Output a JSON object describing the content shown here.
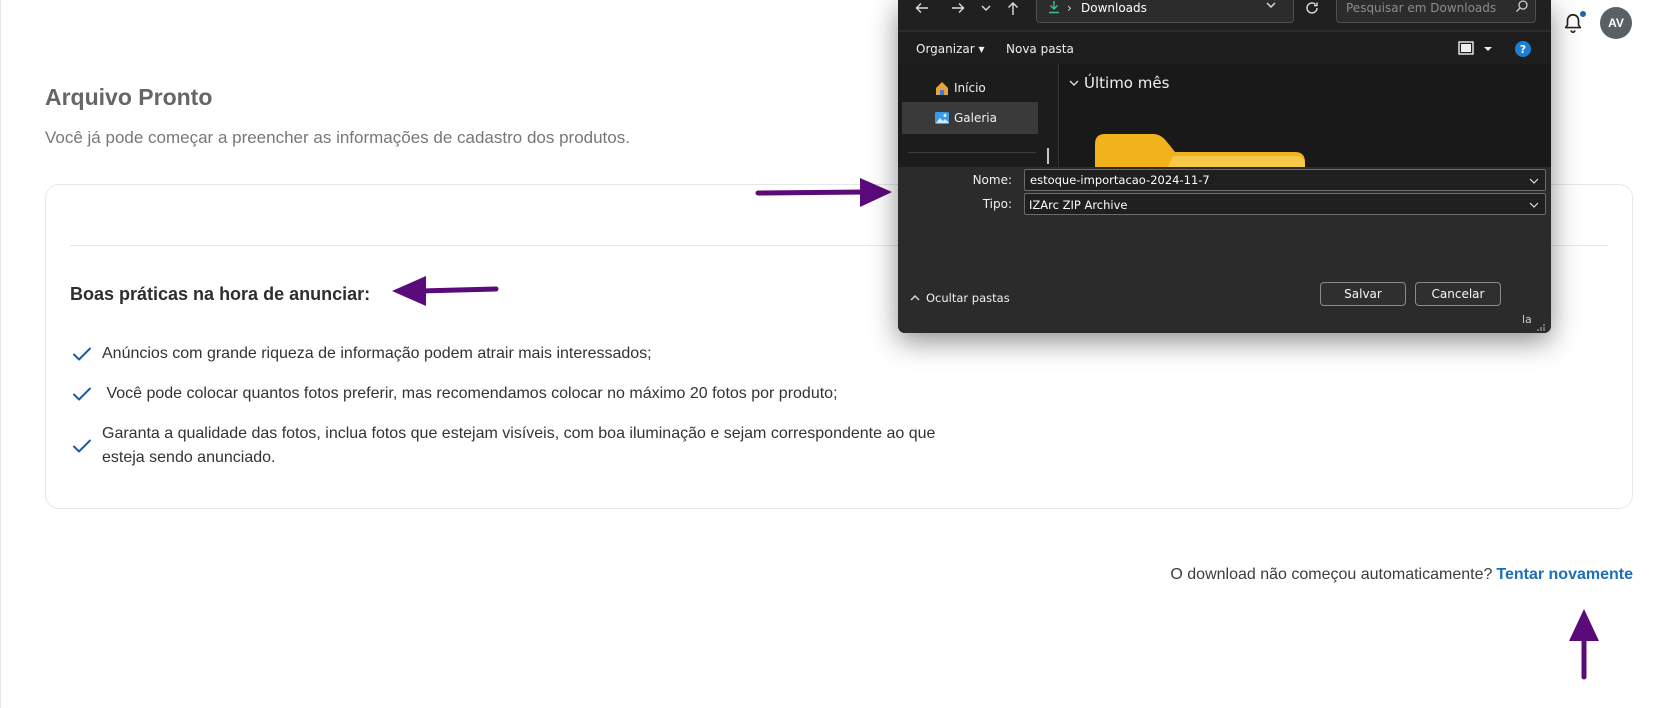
{
  "app": {
    "notification_icon": "bell-icon",
    "avatar_initials": "AV",
    "accent_color": "#1e6fb5",
    "annotation_color": "#5b0a7a"
  },
  "page": {
    "title": "Arquivo Pronto",
    "subtitle": "Você já pode começar a preencher as informações de cadastro dos produtos."
  },
  "tips": {
    "heading": "Boas práticas na hora de anunciar:",
    "items": [
      "Anúncios com grande riqueza de informação podem atrair mais interessados;",
      " Você pode colocar quantos fotos preferir, mas recomendamos colocar no máximo 20 fotos por produto;",
      "Garanta a qualidade das fotos, inclua fotos que estejam visíveis, com boa iluminação e sejam correspondente ao que esteja sendo anunciado."
    ]
  },
  "retry": {
    "text": "O download não começou automaticamente?",
    "link": "Tentar novamente"
  },
  "dialog": {
    "breadcrumb": "Downloads",
    "search_placeholder": "Pesquisar em Downloads",
    "toolbar": {
      "organize": "Organizar",
      "new_folder": "Nova pasta",
      "help": "?"
    },
    "nav_items": [
      {
        "label": "Início",
        "icon": "home-icon"
      },
      {
        "label": "Galeria",
        "icon": "gallery-icon",
        "selected": true
      }
    ],
    "group_header": "Último mês",
    "name_label": "Nome:",
    "name_value": "estoque-importacao-2024-11-7",
    "type_label": "Tipo:",
    "type_value": "IZArc ZIP Archive",
    "hide_folders": "Ocultar pastas",
    "save": "Salvar",
    "cancel": "Cancelar",
    "resize_label": "la"
  }
}
